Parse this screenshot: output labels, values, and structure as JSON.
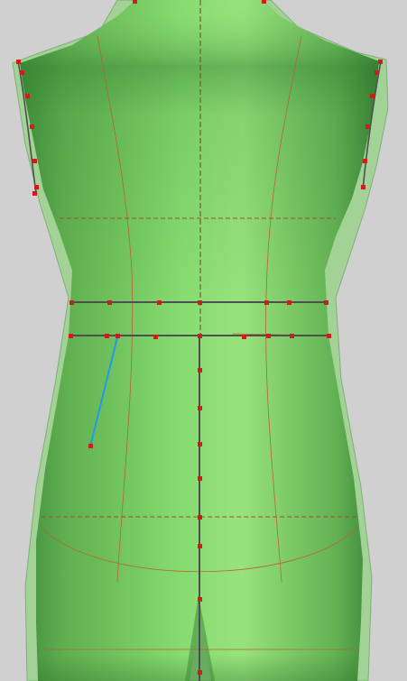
{
  "viewport": {
    "background": "#cfd0cf",
    "body_color": "#7fd46a",
    "body_shade": "#3f8f3a",
    "guide_color": "#b8652d",
    "seam_color": "#4d4f50",
    "point_color": "#d41b1b",
    "active_line_color": "#1e9be8"
  }
}
